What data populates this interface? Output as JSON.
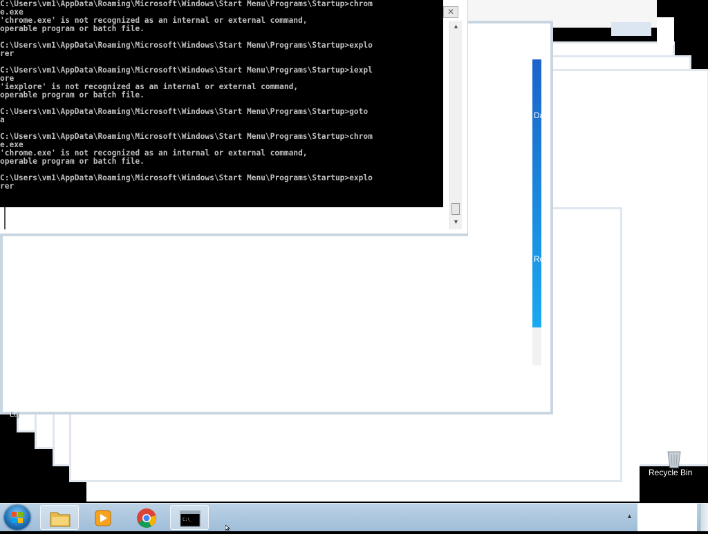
{
  "console": {
    "lines": [
      "C:\\Users\\vm1\\AppData\\Roaming\\Microsoft\\Windows\\Start Menu\\Programs\\Startup>chrom",
      "e.exe",
      "'chrome.exe' is not recognized as an internal or external command,",
      "operable program or batch file.",
      "",
      "C:\\Users\\vm1\\AppData\\Roaming\\Microsoft\\Windows\\Start Menu\\Programs\\Startup>explo",
      "rer",
      "",
      "C:\\Users\\vm1\\AppData\\Roaming\\Microsoft\\Windows\\Start Menu\\Programs\\Startup>iexpl",
      "ore",
      "'iexplore' is not recognized as an internal or external command,",
      "operable program or batch file.",
      "",
      "C:\\Users\\vm1\\AppData\\Roaming\\Microsoft\\Windows\\Start Menu\\Programs\\Startup>goto",
      "a",
      "",
      "C:\\Users\\vm1\\AppData\\Roaming\\Microsoft\\Windows\\Start Menu\\Programs\\Startup>chrom",
      "e.exe",
      "'chrome.exe' is not recognized as an internal or external command,",
      "operable program or batch file.",
      "",
      "C:\\Users\\vm1\\AppData\\Roaming\\Microsoft\\Windows\\Start Menu\\Programs\\Startup>explo",
      "rer"
    ]
  },
  "background_window": {
    "strip_label_1": "Da",
    "strip_label_2": "Ro"
  },
  "desktop": {
    "recycle_bin_label": "Recycle Bin",
    "partial_label": "La"
  },
  "taskbar": {
    "items": [
      {
        "name": "start",
        "icon": "windows-orb-icon"
      },
      {
        "name": "explorer",
        "icon": "folder-icon"
      },
      {
        "name": "media-player",
        "icon": "media-player-icon"
      },
      {
        "name": "chrome",
        "icon": "chrome-icon"
      },
      {
        "name": "cmd",
        "icon": "cmd-icon",
        "cmd_text": "C:\\_"
      }
    ],
    "tray_arrow": "▲"
  },
  "colors": {
    "accent_blue": "#1b63c9",
    "taskbar": "#a9c4dd"
  }
}
